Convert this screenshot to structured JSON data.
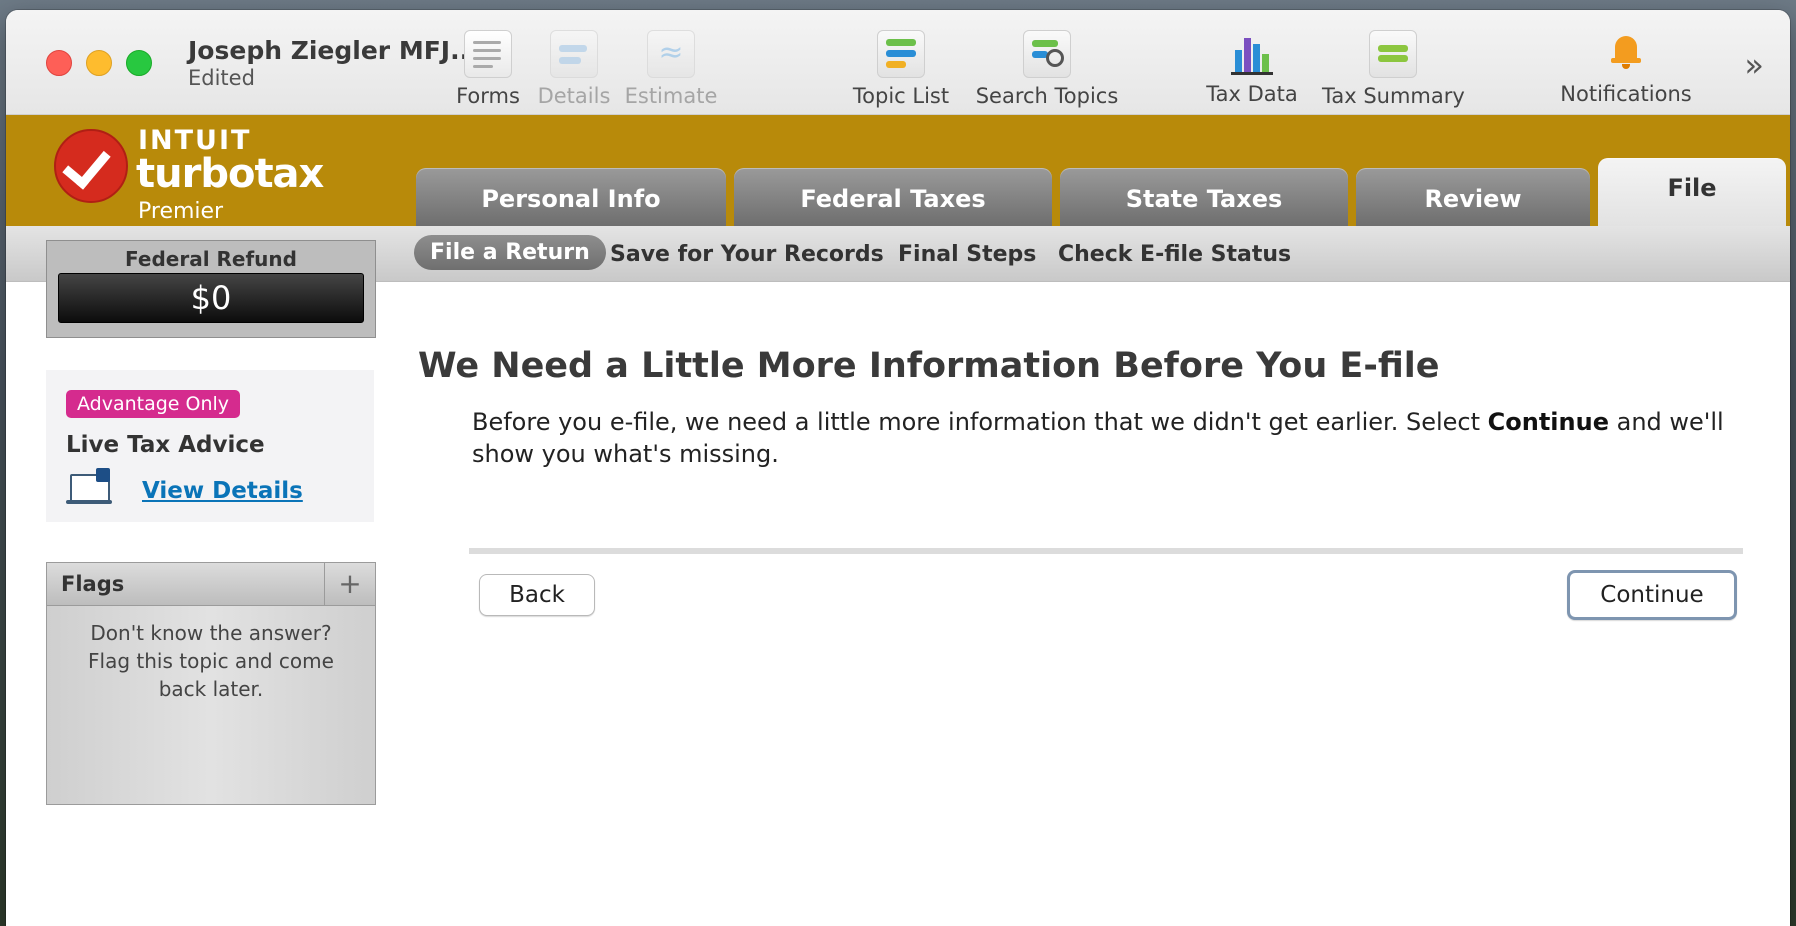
{
  "window": {
    "doc_title": "Joseph Ziegler MFJ...",
    "doc_status": "Edited"
  },
  "toolbar": {
    "items": [
      {
        "label": "Forms",
        "icon": "forms-icon",
        "enabled": true
      },
      {
        "label": "Details",
        "icon": "details-icon",
        "enabled": false
      },
      {
        "label": "Estimate",
        "icon": "estimate-icon",
        "enabled": false
      },
      {
        "label": "Topic List",
        "icon": "topic-list-icon",
        "enabled": true
      },
      {
        "label": "Search Topics",
        "icon": "search-topics-icon",
        "enabled": true
      },
      {
        "label": "Tax Data",
        "icon": "tax-data-icon",
        "enabled": true
      },
      {
        "label": "Tax Summary",
        "icon": "tax-summary-icon",
        "enabled": true
      },
      {
        "label": "Notifications",
        "icon": "bell-icon",
        "enabled": true
      }
    ],
    "overflow": "»"
  },
  "brand": {
    "company": "INTUIT",
    "product": "turbotax",
    "edition": "Premier"
  },
  "tabs": [
    {
      "label": "Personal Info",
      "active": false
    },
    {
      "label": "Federal Taxes",
      "active": false
    },
    {
      "label": "State Taxes",
      "active": false
    },
    {
      "label": "Review",
      "active": false
    },
    {
      "label": "File",
      "active": true
    }
  ],
  "subnav": [
    {
      "label": "File a Return",
      "active": true
    },
    {
      "label": "Save for Your Records",
      "active": false
    },
    {
      "label": "Final Steps",
      "active": false
    },
    {
      "label": "Check E-file Status",
      "active": false
    }
  ],
  "refund": {
    "label": "Federal Refund",
    "amount": "$0"
  },
  "promo": {
    "badge": "Advantage Only",
    "title": "Live Tax Advice",
    "link": "View Details"
  },
  "flags": {
    "title": "Flags",
    "add": "+",
    "text": "Don't know the answer? Flag this topic and come back later."
  },
  "main": {
    "heading": "We Need a Little More Information Before You E-file",
    "para_before": "Before you e-file, we need a little more information that we didn't get earlier. Select ",
    "para_bold": "Continue",
    "para_after": " and we'll show you what's missing.",
    "back_label": "Back",
    "continue_label": "Continue"
  },
  "colors": {
    "brand_band": "#b88a0a",
    "badge": "#d52b8e",
    "link": "#0a74b8",
    "logo_red": "#d52b1e"
  }
}
